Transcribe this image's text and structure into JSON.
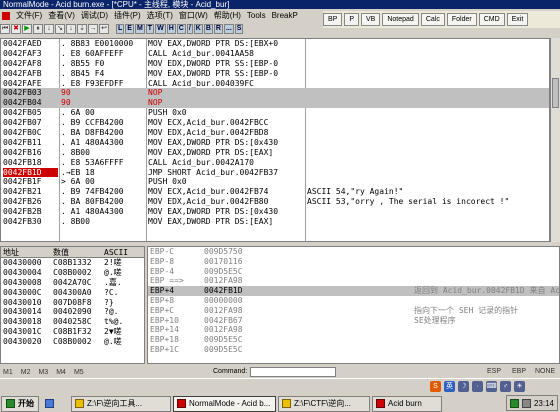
{
  "window": {
    "title": "NormalMode - Acid burn.exe - [*CPU* - 主线程, 模块 - Acid_bur]"
  },
  "menu": [
    "文件(F)",
    "查看(V)",
    "调试(D)",
    "插件(P)",
    "选项(T)",
    "窗口(W)",
    "帮助(H)",
    "Tools",
    "BreakP"
  ],
  "toolbar": {
    "buttons": [
      "⏮",
      "✖",
      "▶",
      "⏸",
      "↓",
      "↘",
      "↓",
      "⇣",
      "→",
      "↩"
    ],
    "letters": [
      "L",
      "E",
      "M",
      "T",
      "W",
      "H",
      "C",
      "/",
      "K",
      "B",
      "R",
      "...",
      "S"
    ]
  },
  "pluginbar": [
    "BP",
    "P",
    "VB",
    "Notepad",
    "Calc",
    "Folder",
    "CMD",
    "Exit"
  ],
  "disasm": [
    {
      "addr": "0042FAED",
      "hex": ". 8B83 E0010000",
      "asm": "MOV EAX,DWORD PTR DS:[EBX+0",
      "comment": ""
    },
    {
      "addr": "0042FAF3",
      "hex": ". E8 60AFFEFF",
      "asm": "CALL Acid_bur.0041AA58",
      "comment": ""
    },
    {
      "addr": "0042FAF8",
      "hex": ". 8B55 F0",
      "asm": "MOV EDX,DWORD PTR SS:[EBP-0",
      "comment": ""
    },
    {
      "addr": "0042FAFB",
      "hex": ". 8B45 F4",
      "asm": "MOV EAX,DWORD PTR SS:[EBP-0",
      "comment": ""
    },
    {
      "addr": "0042FAFE",
      "hex": ". E8 F93EFDFF",
      "asm": "CALL Acid_bur.004039FC",
      "comment": ""
    },
    {
      "addr": "0042FB03",
      "hex": "90",
      "asm": "NOP",
      "comment": ""
    },
    {
      "addr": "0042FB04",
      "hex": "90",
      "asm": "NOP",
      "comment": ""
    },
    {
      "addr": "0042FB05",
      "hex": ". 6A 00",
      "asm": "PUSH 0x0",
      "comment": ""
    },
    {
      "addr": "0042FB07",
      "hex": ". B9 CCFB4200",
      "asm": "MOV ECX,Acid_bur.0042FBCC",
      "comment": ""
    },
    {
      "addr": "0042FB0C",
      "hex": ". BA D8FB4200",
      "asm": "MOV EDX,Acid_bur.0042FBD8",
      "comment": ""
    },
    {
      "addr": "0042FB11",
      "hex": ". A1 480A4300",
      "asm": "MOV EAX,DWORD PTR DS:[0x430",
      "comment": ""
    },
    {
      "addr": "0042FB16",
      "hex": ". 8B00",
      "asm": "MOV EAX,DWORD PTR DS:[EAX]",
      "comment": ""
    },
    {
      "addr": "0042FB18",
      "hex": ". E8 53A6FFFF",
      "asm": "CALL Acid_bur.0042A170",
      "comment": ""
    },
    {
      "addr": "0042FB1D",
      "hex": ".→EB 18",
      "asm": "JMP SHORT Acid_bur.0042FB37",
      "comment": ""
    },
    {
      "addr": "0042FB1F",
      "hex": "> 6A 00",
      "asm": "PUSH 0x0",
      "comment": ""
    },
    {
      "addr": "0042FB21",
      "hex": ". B9 74FB4200",
      "asm": "MOV ECX,Acid_bur.0042FB74",
      "comment": "ASCII 54,\"ry Again!\""
    },
    {
      "addr": "0042FB26",
      "hex": ". BA 80FB4200",
      "asm": "MOV EDX,Acid_bur.0042FB80",
      "comment": "ASCII 53,\"orry , The serial is incorect !\""
    },
    {
      "addr": "0042FB2B",
      "hex": ". A1 480A4300",
      "asm": "MOV EAX,DWORD PTR DS:[0x430",
      "comment": ""
    },
    {
      "addr": "0042FB30",
      "hex": ". 8B00",
      "asm": "MOV EAX,DWORD PTR DS:[EAX]",
      "comment": ""
    }
  ],
  "dump": {
    "headers": {
      "addr": "地址",
      "value": "数值",
      "ascii": "ASCII"
    },
    "rows": [
      {
        "addr": "00430000",
        "value": "C08B1332",
        "ascii": "2!嗟"
      },
      {
        "addr": "00430004",
        "value": "C08B0002",
        "ascii": "@.嗟"
      },
      {
        "addr": "00430008",
        "value": "0042A70C",
        "ascii": ".嘉."
      },
      {
        "addr": "0043000C",
        "value": "004300A0",
        "ascii": "?C."
      },
      {
        "addr": "00430010",
        "value": "007D08F8",
        "ascii": "?}"
      },
      {
        "addr": "00430014",
        "value": "00402090",
        "ascii": "?@."
      },
      {
        "addr": "00430018",
        "value": "0040258C",
        "ascii": "t%@."
      },
      {
        "addr": "0043001C",
        "value": "C08B1F32",
        "ascii": "2▼嗟"
      },
      {
        "addr": "00430020",
        "value": "C08B0002",
        "ascii": "@.嗟"
      }
    ]
  },
  "stack": {
    "rows": [
      {
        "label": "EBP-C",
        "value": "009D5750",
        "comment": ""
      },
      {
        "label": "EBP-8",
        "value": "00170116",
        "comment": ""
      },
      {
        "label": "EBP-4",
        "value": "009D5E5C",
        "comment": ""
      },
      {
        "label": "EBP ==>",
        "value": "0012FA98",
        "comment": ""
      },
      {
        "label": "EBP+4",
        "value": "0042FB1D",
        "comment": "返回到 Acid_bur.0042FB1D 来自 Acid_bur.0042A170"
      },
      {
        "label": "EBP+8",
        "value": "00000000",
        "comment": ""
      },
      {
        "label": "EBP+C",
        "value": "0012FA98",
        "comment": "指向下一个 SEH 记录的指针"
      },
      {
        "label": "EBP+10",
        "value": "0042FB67",
        "comment": "SE处理程序"
      },
      {
        "label": "EBP+14",
        "value": "0012FA98",
        "comment": ""
      },
      {
        "label": "EBP+18",
        "value": "009D5E5C",
        "comment": ""
      },
      {
        "label": "EBP+1C",
        "value": "009D5E5C",
        "comment": ""
      }
    ]
  },
  "cmdbar": {
    "tabs": [
      "M1",
      "M2",
      "M3",
      "M4",
      "M5"
    ],
    "command_label": "Command:",
    "right_labels": [
      "ESP",
      "EBP",
      "NONE"
    ]
  },
  "ime": {
    "items": [
      "S",
      "英",
      "☽",
      "·",
      "⌨",
      "♂",
      "☀"
    ]
  },
  "taskbar": {
    "start_label": "开始",
    "tasks": [
      {
        "label": "Z:\\F\\逆向工具...",
        "icon": "folder-icon",
        "active": false
      },
      {
        "label": "NormalMode - Acid b...",
        "icon": "ollydbg-icon",
        "active": true
      },
      {
        "label": "Z:\\F\\CTF\\逆向...",
        "icon": "folder-icon",
        "active": false
      },
      {
        "label": "Acid burn",
        "icon": "app-icon",
        "active": false
      }
    ],
    "clock": "23:14"
  }
}
